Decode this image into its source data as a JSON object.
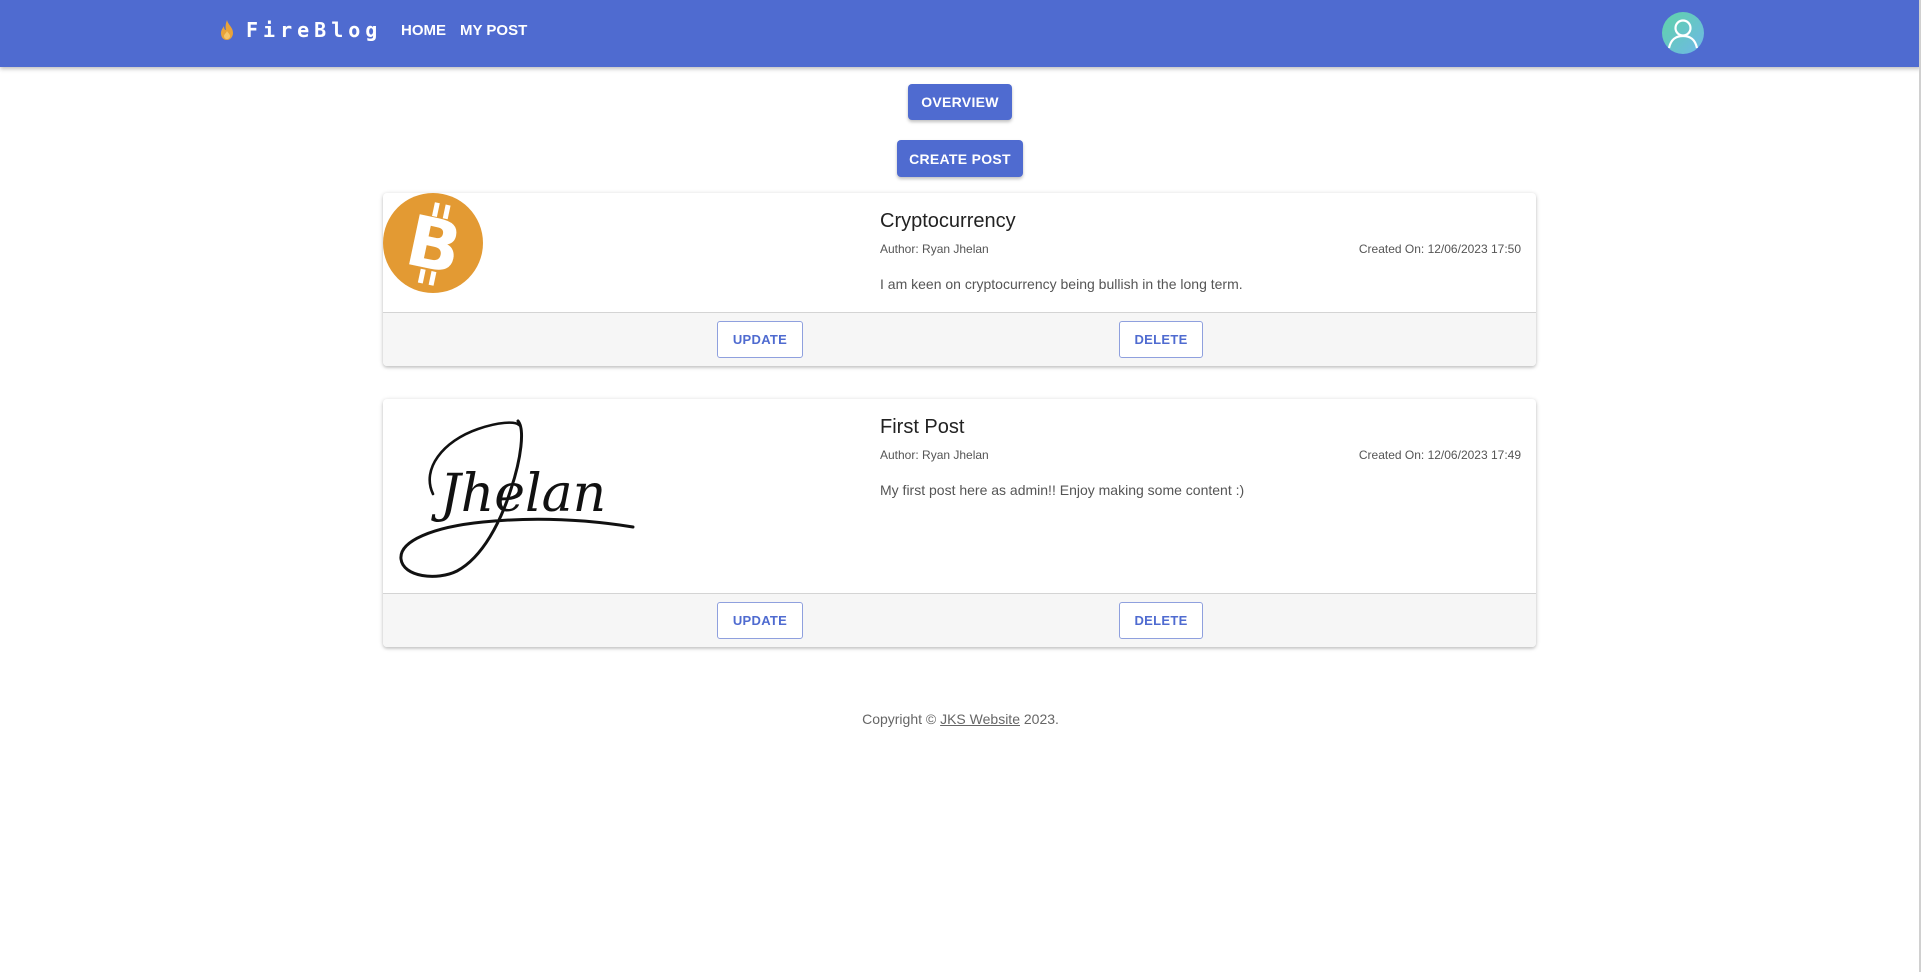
{
  "header": {
    "brand": "FireBlog",
    "nav": [
      "HOME",
      "MY POST"
    ],
    "colors": {
      "appbar": "#4f6bd0",
      "flame": "#e8a33a"
    }
  },
  "actions": {
    "overview": "OVERVIEW",
    "create_post": "CREATE POST"
  },
  "posts": [
    {
      "image": "bitcoin-logo",
      "title": "Cryptocurrency",
      "author": "Author: Ryan Jhelan",
      "created": "Created On: 12/06/2023 17:50",
      "body": "I am keen on cryptocurrency being bullish in the long term.",
      "update_label": "UPDATE",
      "delete_label": "DELETE"
    },
    {
      "image": "signature",
      "signature_text": "Jhelan",
      "title": "First Post",
      "author": "Author: Ryan Jhelan",
      "created": "Created On: 12/06/2023 17:49",
      "body": "My first post here as admin!! Enjoy making some content :)",
      "update_label": "UPDATE",
      "delete_label": "DELETE"
    }
  ],
  "footer": {
    "prefix": "Copyright © ",
    "link": "JKS Website",
    "suffix": " 2023."
  }
}
